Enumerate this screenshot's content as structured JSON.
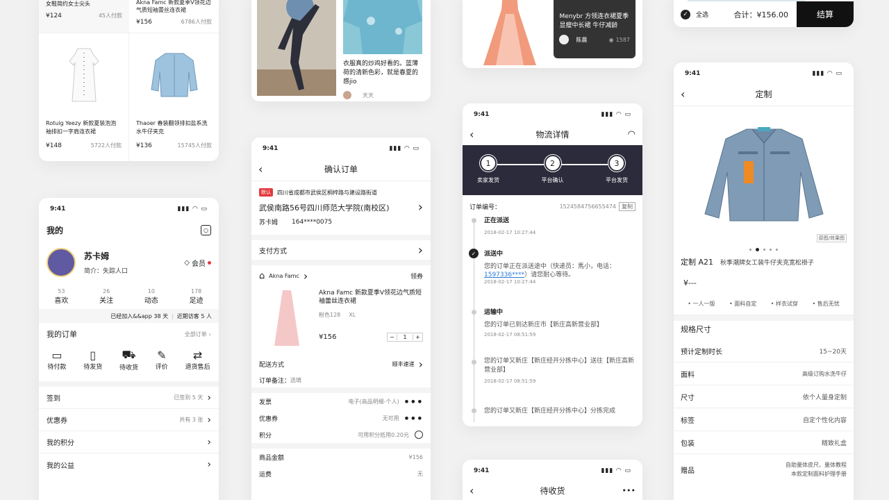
{
  "status_time": "9:41",
  "card1": {
    "top": [
      {
        "title": "女鞋简约女士尖头",
        "price": "¥124",
        "sold": "45人付款"
      },
      {
        "title": "Akna Famc  新款夏季V领花边气质短袖蕾丝连衣裙",
        "price": "¥156",
        "sold": "6786人付款"
      }
    ],
    "items": [
      {
        "title": "Rotuig  Yeezy 新款夏装泡泡袖排扣一字肩连衣裙",
        "price": "¥148",
        "sold": "5722人付款"
      },
      {
        "title": "Thaoer  春装翻领排扣盐系洗水牛仔夹克",
        "price": "¥136",
        "sold": "15745人付款"
      }
    ]
  },
  "card2": {
    "caption": "衣服真的炒鸡好看的。蓝薄荷的清新色彩，就是春夏的感jio",
    "author": "天天"
  },
  "card3": {
    "caption": "Menybr 方领连衣裙夏季显瘦中长裙 牛仔减龄",
    "author": "陈晨",
    "views": "1587"
  },
  "card4": {
    "select_all": "全选",
    "total": "合计：¥156.00",
    "checkout": "结算"
  },
  "mine": {
    "title": "我的",
    "name": "苏卡姆",
    "bio": "简介：失踪人口",
    "member": "会员",
    "stats": [
      {
        "num": "53",
        "label": "喜欢"
      },
      {
        "num": "26",
        "label": "关注"
      },
      {
        "num": "10",
        "label": "动态"
      },
      {
        "num": "178",
        "label": "足迹"
      }
    ],
    "joined": "已经加入&&app 38 天",
    "visitors": "近期访客 5 人",
    "orders_title": "我的订单",
    "all_orders": "全部订单",
    "order_icons": [
      "待付款",
      "待发货",
      "待收货",
      "评价",
      "退货售后"
    ],
    "list": [
      {
        "label": "签到",
        "value": "已签到 5 天"
      },
      {
        "label": "优惠券",
        "value": "共有 3 张"
      },
      {
        "label": "我的积分",
        "value": ""
      },
      {
        "label": "我的公益",
        "value": ""
      }
    ]
  },
  "confirm": {
    "title": "确认订单",
    "default_tag": "默认",
    "region": "四川省成都市武侯区桐梓路与建设路街道",
    "address": "武侯南路56号四川师范大学院(南校区)",
    "name": "苏卡姆",
    "phone": "164****0075",
    "pay_method": "支付方式",
    "shop": "Akna Famc",
    "coupon": "领券",
    "product_title": "Akna Famc  新款夏季V领花边气质短袖蕾丝连衣裙",
    "spec_color": "粉色128",
    "spec_size": "XL",
    "price": "¥156",
    "qty": "1",
    "delivery_label": "配送方式",
    "delivery_value": "顺丰速递",
    "remark_label": "订单备注：",
    "remark_value": "选填",
    "invoice_label": "发票",
    "invoice_value": "电子(商品明细-个人)",
    "coupon_label": "优惠券",
    "coupon_value": "无可用",
    "points_label": "积分",
    "points_value": "可用积分抵用0.20元",
    "goods_label": "商品金额",
    "goods_value": "¥156",
    "freight_label": "运费",
    "freight_value": "无"
  },
  "logistics": {
    "title": "物流详情",
    "steps": [
      {
        "num": "1",
        "label": "卖家发货"
      },
      {
        "num": "2",
        "label": "平台确认"
      },
      {
        "num": "3",
        "label": "平台发货"
      }
    ],
    "order_label": "订单编号：",
    "order_no": "1524584756655474",
    "copy": "复制",
    "events": [
      {
        "status": "正在派送",
        "text": "",
        "time": "2018-02-17 10:27:44"
      },
      {
        "status": "派送中",
        "text": "您的订单正在派送途中（快递员：馬小，电话：",
        "phone": "1597336****",
        "text2": "）请您耐心等待。",
        "time": "2018-02-17 10:27:44"
      },
      {
        "status": "运输中",
        "text": "您的订单已到达新庄市【新庄高新营业部】",
        "time": "2018-02-17 08:51:59"
      },
      {
        "status": "",
        "text": "您的订单又新庄【新庄经开分拣中心】送往【新庄高新营业部】",
        "time": "2018-02-17 08:51:59"
      },
      {
        "status": "",
        "text": "您的订单又新庄【新庄经开分拣中心】分拣完成",
        "time": ""
      }
    ]
  },
  "pending": {
    "title": "待收货"
  },
  "custom": {
    "title": "定制",
    "toggle": "原图/效果图",
    "name_prefix": "定制 A21",
    "name": "秋季潮牌女工装牛仔夹克宽松褂子",
    "price": "¥---",
    "features": [
      "一人一版",
      "面料自定",
      "样衣试穿",
      "售后无忧"
    ],
    "spec_title": "规格尺寸",
    "specs": [
      {
        "label": "预计定制时长",
        "value": "15~20天"
      },
      {
        "label": "面料",
        "value": "高级订购水洗牛仔"
      },
      {
        "label": "尺寸",
        "value": "依个人量身定制"
      },
      {
        "label": "标签",
        "value": "自定个性化内容"
      },
      {
        "label": "包装",
        "value": "精致礼盒"
      },
      {
        "label": "赠品",
        "value": "自助量体皮尺、量体教程\n本款定制面料护理手册"
      }
    ]
  },
  "colors": {
    "accent": "#e4393c",
    "dark_header": "#2b2b3b",
    "link": "#2a7ad8"
  }
}
